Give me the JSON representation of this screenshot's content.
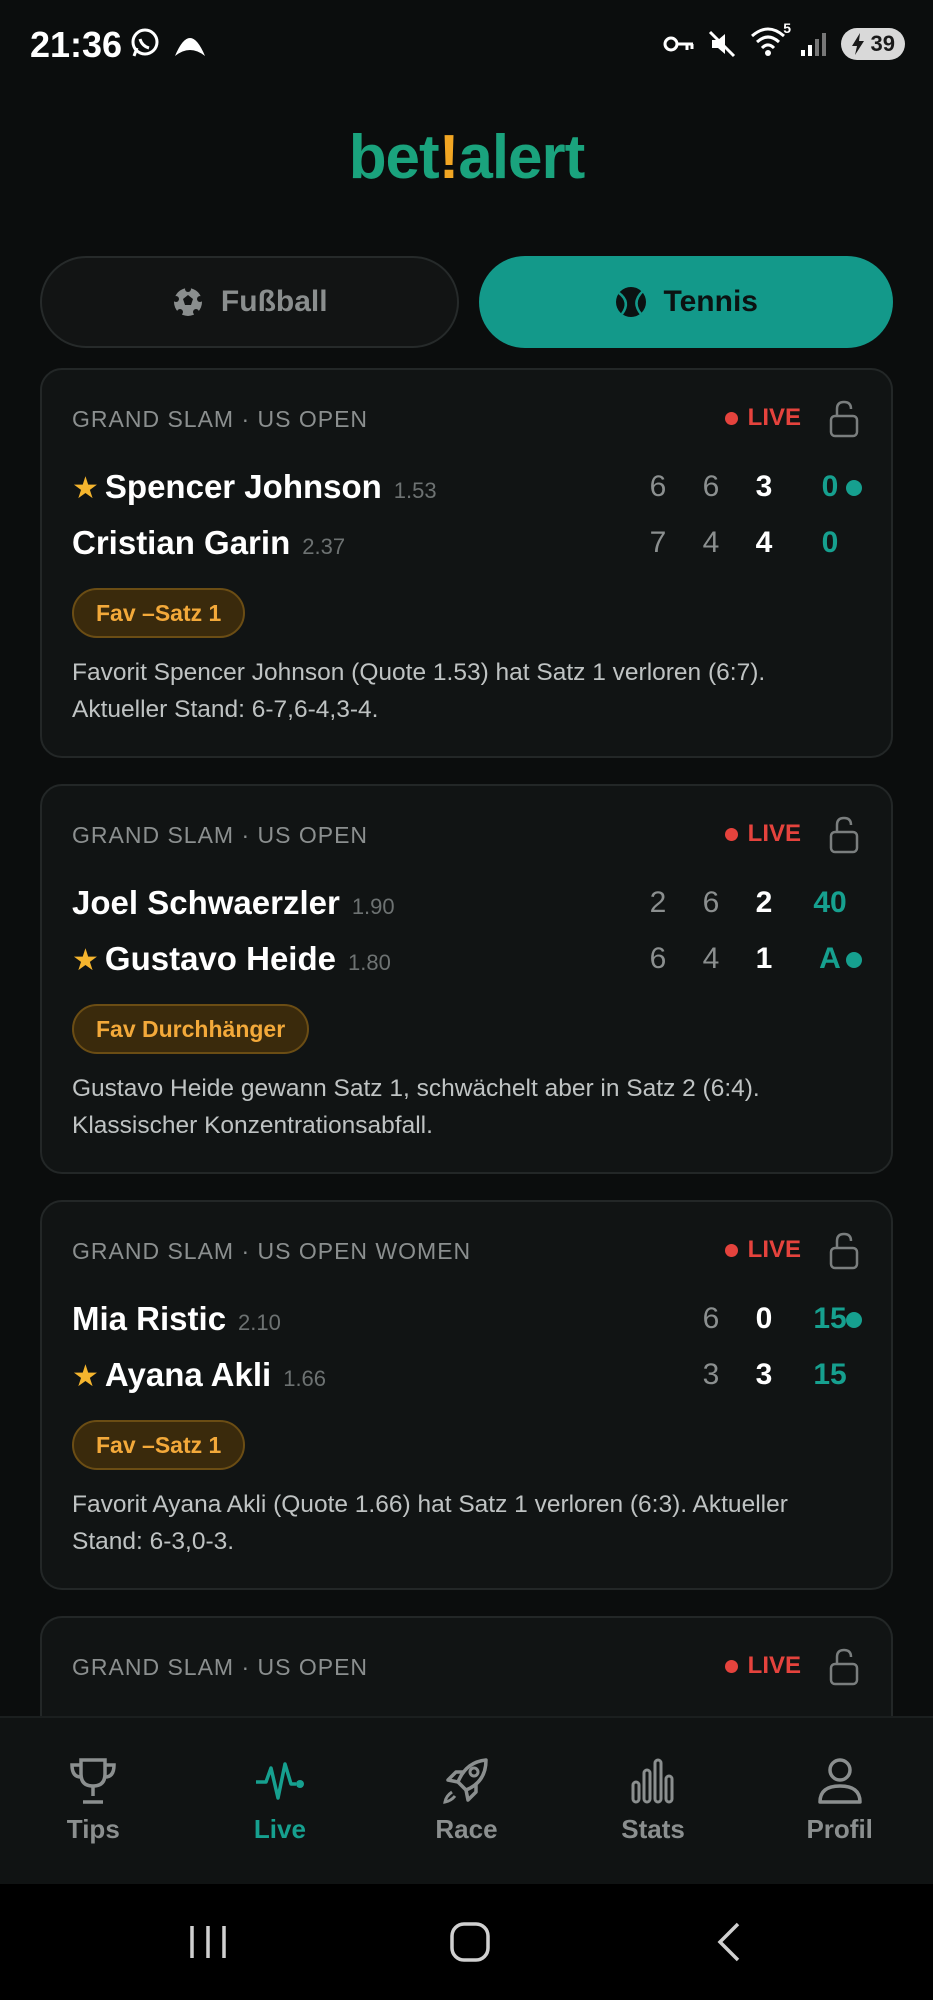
{
  "status": {
    "time": "21:36",
    "wifi_badge": "5",
    "battery": "39"
  },
  "logo": {
    "part1": "bet",
    "bang": "!",
    "part2": "alert"
  },
  "tabs": [
    {
      "label": "Fußball",
      "icon": "soccer-ball-icon",
      "active": false
    },
    {
      "label": "Tennis",
      "icon": "tennis-ball-icon",
      "active": true
    }
  ],
  "matches": [
    {
      "tournament": "GRAND SLAM · US OPEN",
      "live": "LIVE",
      "players": [
        {
          "name": "Spencer Johnson",
          "odds": "1.53",
          "fav": true,
          "sets": [
            "6",
            "6"
          ],
          "current": "3",
          "game": "0",
          "serving": true
        },
        {
          "name": "Cristian Garin",
          "odds": "2.37",
          "fav": false,
          "sets": [
            "7",
            "4"
          ],
          "current": "4",
          "game": "0",
          "serving": false
        }
      ],
      "badge": "Fav –Satz 1",
      "desc_line1": "Favorit Spencer Johnson (Quote 1.53) hat Satz 1 verloren (6:7).",
      "desc_line2": "Aktueller Stand: 6-7,6-4,3-4."
    },
    {
      "tournament": "GRAND SLAM · US OPEN",
      "live": "LIVE",
      "players": [
        {
          "name": "Joel Schwaerzler",
          "odds": "1.90",
          "fav": false,
          "sets": [
            "2",
            "6"
          ],
          "current": "2",
          "game": "40",
          "serving": false
        },
        {
          "name": "Gustavo Heide",
          "odds": "1.80",
          "fav": true,
          "sets": [
            "6",
            "4"
          ],
          "current": "1",
          "game": "A",
          "serving": true
        }
      ],
      "badge": "Fav Durchhänger",
      "desc_line1": "Gustavo Heide gewann Satz 1, schwächelt aber in Satz 2 (6:4).",
      "desc_line2": "Klassischer Konzentrationsabfall."
    },
    {
      "tournament": "GRAND SLAM · US OPEN WOMEN",
      "live": "LIVE",
      "players": [
        {
          "name": "Mia Ristic",
          "odds": "2.10",
          "fav": false,
          "sets": [
            "6"
          ],
          "current": "0",
          "game": "15",
          "serving": true
        },
        {
          "name": "Ayana Akli",
          "odds": "1.66",
          "fav": true,
          "sets": [
            "3"
          ],
          "current": "3",
          "game": "15",
          "serving": false
        }
      ],
      "badge": "Fav –Satz 1",
      "desc_line1": "Favorit Ayana Akli (Quote 1.66) hat Satz 1 verloren (6:3). Aktueller",
      "desc_line2": "Stand: 6-3,0-3."
    },
    {
      "tournament": "GRAND SLAM · US OPEN",
      "live": "LIVE"
    }
  ],
  "nav": [
    {
      "label": "Tips",
      "icon": "trophy-icon",
      "active": false
    },
    {
      "label": "Live",
      "icon": "pulse-icon",
      "active": true
    },
    {
      "label": "Race",
      "icon": "rocket-icon",
      "active": false
    },
    {
      "label": "Stats",
      "icon": "bar-chart-icon",
      "active": false
    },
    {
      "label": "Profil",
      "icon": "user-icon",
      "active": false
    }
  ],
  "colors": {
    "accent": "#13998a",
    "live": "#e5433d",
    "badge": "#f3a93a",
    "logo_green": "#1aa37d",
    "logo_bang": "#f2a623"
  }
}
